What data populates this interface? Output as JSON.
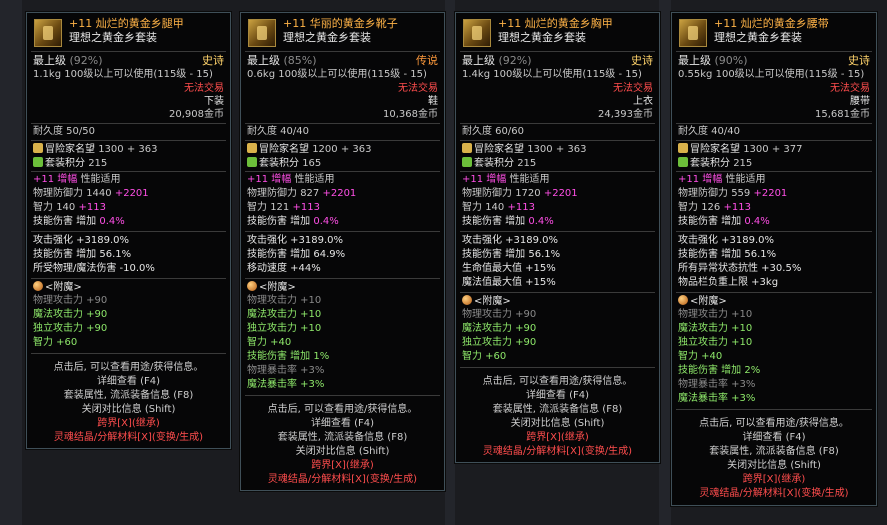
{
  "cards": [
    {
      "name": "+11 灿烂的黄金乡腿甲",
      "set": "理想之黄金乡套装",
      "level_label": "最上级",
      "level_pct": "(92%)",
      "rarity": "史诗",
      "weight": "1.1kg",
      "req": "100级以上可以使用(115级 - 15)",
      "trade": "无法交易",
      "slot": "下装",
      "price": "20,908金币",
      "durability": "耐久度 50/50",
      "renown_label": "冒险家名望",
      "renown": "1300 + 363",
      "setpt_label": "套装积分",
      "setpt": "215",
      "amp": "+11",
      "amp_label": "增幅",
      "amp_suffix": "性能适用",
      "def_label": "物理防御力",
      "def": "1440",
      "def_bonus": "+2201",
      "int_label": "智力",
      "int": "140",
      "int_bonus": "+113",
      "skill_label": "技能伤害 增加",
      "skill": "0.4%",
      "options": [
        "攻击强化 +3189.0%",
        "技能伤害 增加 56.1%",
        "所受物理/魔法伤害 -10.0%"
      ],
      "ench_title": "<附魔>",
      "ench": [
        {
          "t": "物理攻击力 +90",
          "c": "grey"
        },
        {
          "t": "魔法攻击力 +90",
          "c": "green"
        },
        {
          "t": "独立攻击力 +90",
          "c": "green"
        },
        {
          "t": "智力 +60",
          "c": "green"
        }
      ]
    },
    {
      "name": "+11 华丽的黄金乡靴子",
      "set": "理想之黄金乡套装",
      "level_label": "最上级",
      "level_pct": "(85%)",
      "rarity": "传说",
      "weight": "0.6kg",
      "req": "100级以上可以使用(115级 - 15)",
      "trade": "无法交易",
      "slot": "鞋",
      "price": "10,368金币",
      "durability": "耐久度 40/40",
      "renown_label": "冒险家名望",
      "renown": "1200 + 363",
      "setpt_label": "套装积分",
      "setpt": "165",
      "amp": "+11",
      "amp_label": "增幅",
      "amp_suffix": "性能适用",
      "def_label": "物理防御力",
      "def": "827",
      "def_bonus": "+2201",
      "int_label": "智力",
      "int": "121",
      "int_bonus": "+113",
      "skill_label": "技能伤害 增加",
      "skill": "0.4%",
      "options": [
        "攻击强化 +3189.0%",
        "技能伤害 增加 64.9%",
        "移动速度 +44%"
      ],
      "ench_title": "<附魔>",
      "ench": [
        {
          "t": "物理攻击力 +10",
          "c": "grey"
        },
        {
          "t": "魔法攻击力 +10",
          "c": "green"
        },
        {
          "t": "独立攻击力 +10",
          "c": "green"
        },
        {
          "t": "智力 +40",
          "c": "green"
        },
        {
          "t": "技能伤害 增加 1%",
          "c": "green"
        },
        {
          "t": "物理暴击率 +3%",
          "c": "grey"
        },
        {
          "t": "魔法暴击率 +3%",
          "c": "green"
        }
      ]
    },
    {
      "name": "+11 灿烂的黄金乡胸甲",
      "set": "理想之黄金乡套装",
      "level_label": "最上级",
      "level_pct": "(92%)",
      "rarity": "史诗",
      "weight": "1.4kg",
      "req": "100级以上可以使用(115级 - 15)",
      "trade": "无法交易",
      "slot": "上衣",
      "price": "24,393金币",
      "durability": "耐久度 60/60",
      "renown_label": "冒险家名望",
      "renown": "1300 + 363",
      "setpt_label": "套装积分",
      "setpt": "215",
      "amp": "+11",
      "amp_label": "增幅",
      "amp_suffix": "性能适用",
      "def_label": "物理防御力",
      "def": "1720",
      "def_bonus": "+2201",
      "int_label": "智力",
      "int": "140",
      "int_bonus": "+113",
      "skill_label": "技能伤害 增加",
      "skill": "0.4%",
      "options": [
        "攻击强化 +3189.0%",
        "技能伤害 增加 56.1%",
        "生命值最大值 +15%",
        "魔法值最大值 +15%"
      ],
      "ench_title": "<附魔>",
      "ench": [
        {
          "t": "物理攻击力 +90",
          "c": "grey"
        },
        {
          "t": "魔法攻击力 +90",
          "c": "green"
        },
        {
          "t": "独立攻击力 +90",
          "c": "green"
        },
        {
          "t": "智力 +60",
          "c": "green"
        }
      ]
    },
    {
      "name": "+11 灿烂的黄金乡腰带",
      "set": "理想之黄金乡套装",
      "level_label": "最上级",
      "level_pct": "(90%)",
      "rarity": "史诗",
      "weight": "0.55kg",
      "req": "100级以上可以使用(115级 - 15)",
      "trade": "无法交易",
      "slot": "腰带",
      "price": "15,681金币",
      "durability": "耐久度 40/40",
      "renown_label": "冒险家名望",
      "renown": "1300 + 377",
      "setpt_label": "套装积分",
      "setpt": "215",
      "amp": "+11",
      "amp_label": "增幅",
      "amp_suffix": "性能适用",
      "def_label": "物理防御力",
      "def": "559",
      "def_bonus": "+2201",
      "int_label": "智力",
      "int": "126",
      "int_bonus": "+113",
      "skill_label": "技能伤害 增加",
      "skill": "0.4%",
      "options": [
        "攻击强化 +3189.0%",
        "技能伤害 增加 56.1%",
        "所有异常状态抗性 +30.5%",
        "物品栏负重上限 +3kg"
      ],
      "ench_title": "<附魔>",
      "ench": [
        {
          "t": "物理攻击力 +10",
          "c": "grey"
        },
        {
          "t": "魔法攻击力 +10",
          "c": "green"
        },
        {
          "t": "独立攻击力 +10",
          "c": "green"
        },
        {
          "t": "智力 +40",
          "c": "green"
        },
        {
          "t": "技能伤害 增加 2%",
          "c": "green"
        },
        {
          "t": "物理暴击率 +3%",
          "c": "grey"
        },
        {
          "t": "魔法暴击率 +3%",
          "c": "green"
        }
      ]
    }
  ],
  "hints": [
    {
      "t": "点击后, 可以查看用途/获得信息。",
      "c": "white"
    },
    {
      "t": "详细查看 (F4)",
      "c": "white"
    },
    {
      "t": "套装属性, 流派装备信息 (F8)",
      "c": "white"
    },
    {
      "t": "关闭对比信息 (Shift)",
      "c": "white"
    },
    {
      "t": "跨界[X](继承)",
      "c": "red"
    },
    {
      "t": "灵魂结晶/分解材料[X](变换/生成)",
      "c": "red"
    }
  ]
}
